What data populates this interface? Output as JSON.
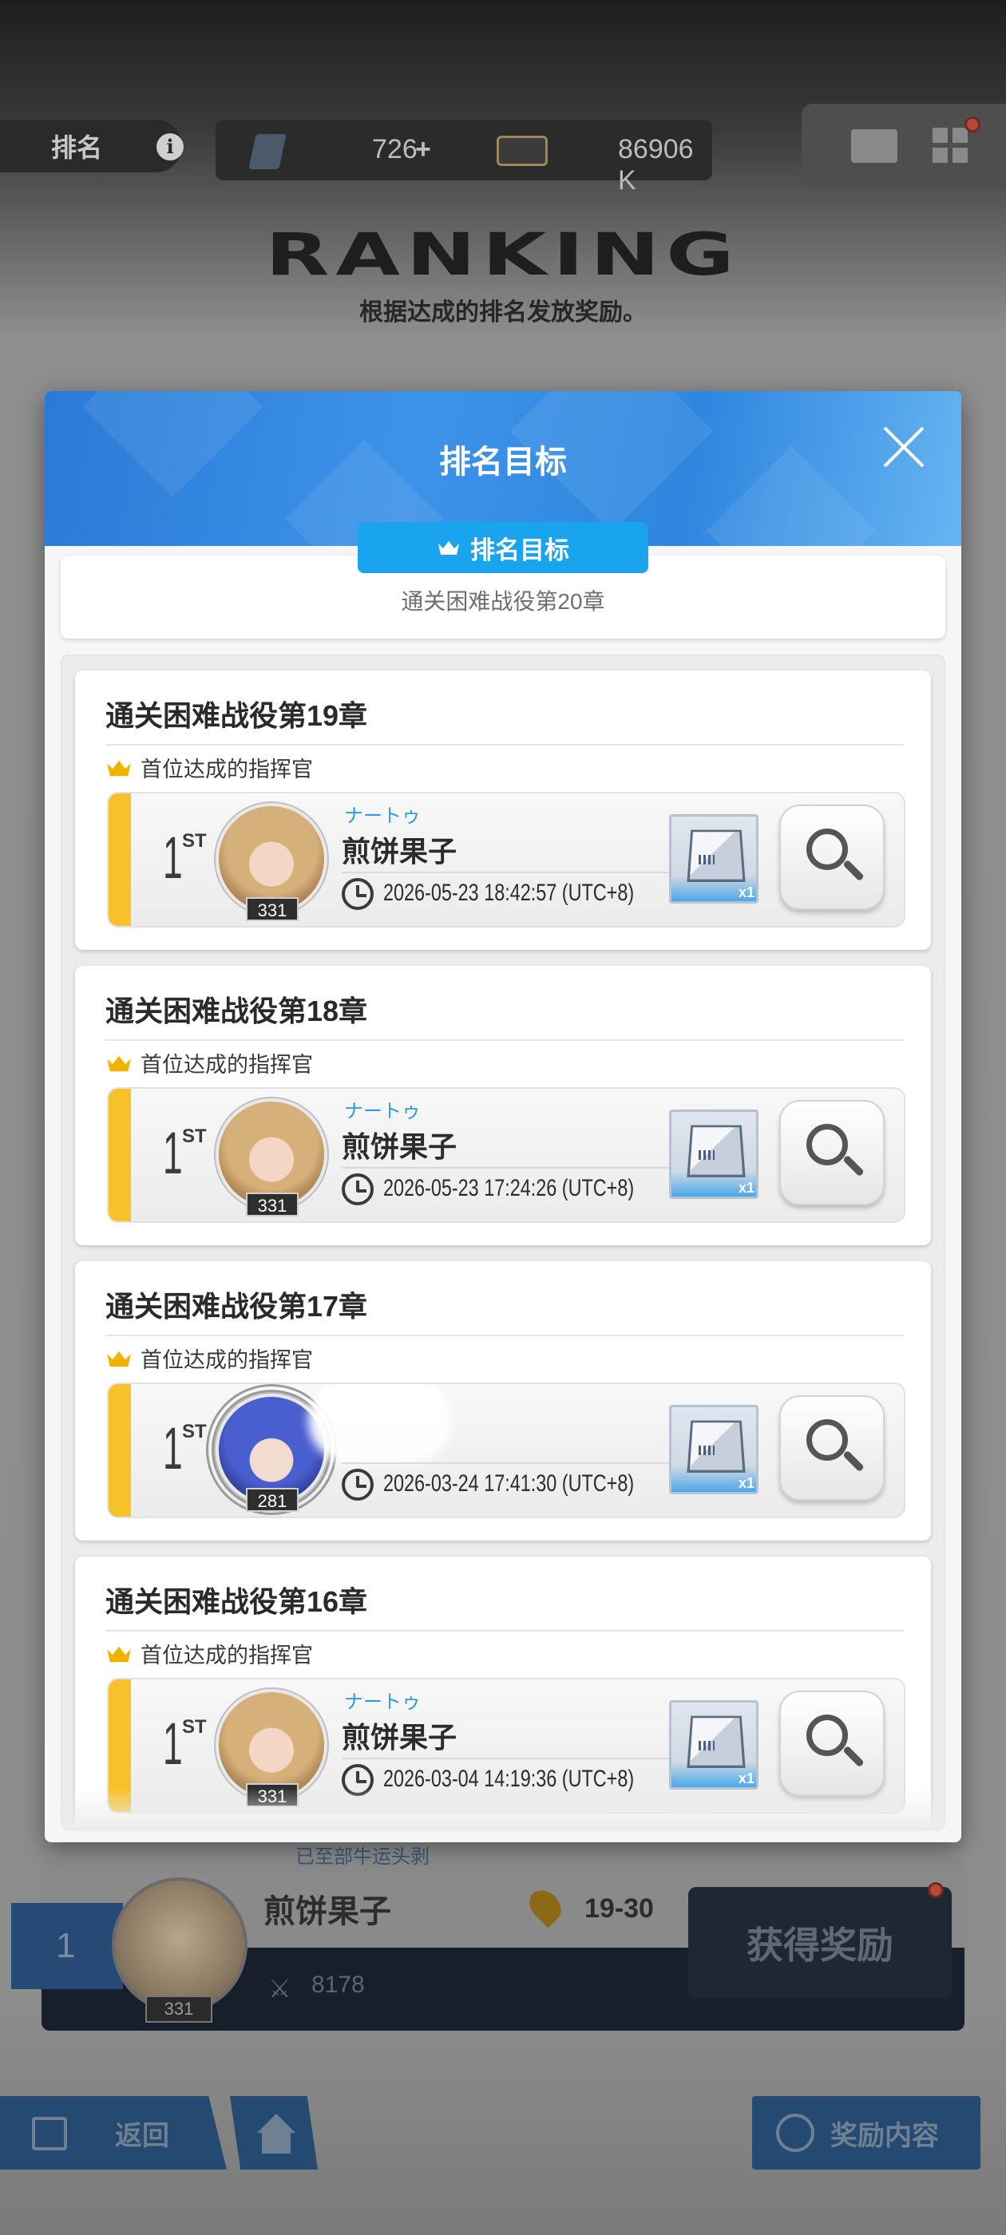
{
  "background": {
    "rank_label": "排名",
    "info_icon": "i",
    "gems": "726",
    "gems_plus": "+",
    "credits": "86906 K",
    "ranking_title": "RANKING",
    "ranking_subtitle": "根据达成的排名发放奖励。",
    "bottom_hint": "已至部牛运头剥",
    "my_rank": "1",
    "my_name": "煎饼果子",
    "my_level": "331",
    "my_power": "8178",
    "my_range": "19-30",
    "get_reward_label": "获得奖励",
    "nav": {
      "back_label": "返回",
      "reward_content_label": "奖励内容"
    }
  },
  "modal": {
    "title": "排名目标",
    "goal_tag_label": "排名目标",
    "goal_text": "通关困难战役第20章",
    "first_achiever_label": "首位达成的指挥官",
    "cards": [
      {
        "title": "通关困难战役第19章",
        "rank": "1",
        "rank_suffix": "ST",
        "kana": "ナートゥ",
        "name": "煎饼果子",
        "level": "331",
        "timestamp": "2026-05-23 18:42:57 (UTC+8)",
        "item_qty": "x1"
      },
      {
        "title": "通关困难战役第18章",
        "rank": "1",
        "rank_suffix": "ST",
        "kana": "ナートゥ",
        "name": "煎饼果子",
        "level": "331",
        "timestamp": "2026-05-23 17:24:26 (UTC+8)",
        "item_qty": "x1"
      },
      {
        "title": "通关困难战役第17章",
        "rank": "1",
        "rank_suffix": "ST",
        "kana": "",
        "name": "",
        "level": "281",
        "timestamp": "2026-03-24 17:41:30 (UTC+8)",
        "item_qty": "x1"
      },
      {
        "title": "通关困难战役第16章",
        "rank": "1",
        "rank_suffix": "ST",
        "kana": "ナートゥ",
        "name": "煎饼果子",
        "level": "331",
        "timestamp": "2026-03-04 14:19:36 (UTC+8)",
        "item_qty": "x1"
      }
    ]
  },
  "colors": {
    "header_blue": "#2f86df",
    "tag_blue": "#1aa4f0",
    "rank_bar_yellow": "#f7c12b",
    "kana_blue": "#2c9ee0",
    "crown_gold": "#f2b300"
  },
  "icons": [
    "info-icon",
    "gem-icon",
    "ticket-icon",
    "mail-icon",
    "grid-icon",
    "close-icon",
    "crown-icon",
    "clock-icon",
    "search-icon",
    "box-icon",
    "location-pin-icon",
    "swords-icon",
    "back-icon",
    "home-icon",
    "medal-icon"
  ]
}
